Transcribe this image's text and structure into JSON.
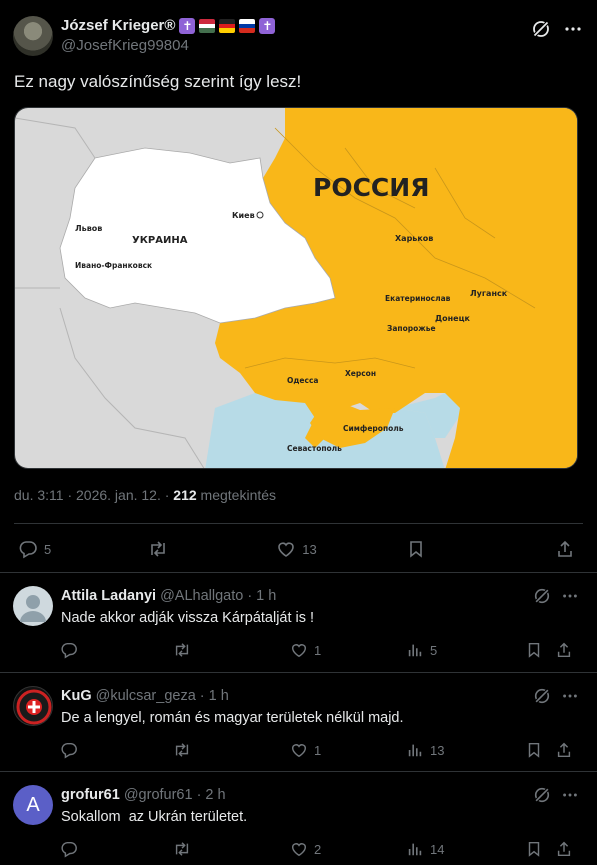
{
  "post": {
    "author_name": "József Krieger®",
    "author_badges": [
      "latin-cross-icon",
      "flag-hungary",
      "flag-germany",
      "flag-russia",
      "latin-cross-icon"
    ],
    "cross_glyph": "✝",
    "handle": "@JosefKrieg99804",
    "text": "Ez nagy valószínűség szerint így lesz!",
    "map_labels": {
      "russia": "РОССИЯ",
      "ukraine": "УКРАИНА",
      "kiev": "Киев",
      "lvov": "Львов",
      "ivano": "Ивано-Франковск",
      "kharkov": "Харьков",
      "ekaterinoslav": "Екатеринослав",
      "lugansk": "Луганск",
      "donetsk": "Донецк",
      "zaporozhye": "Запорожье",
      "odessa": "Одесса",
      "kherson": "Херсон",
      "simferopol": "Симферополь",
      "sevastopol": "Севастополь"
    },
    "timestamp": "du. 3:11 · 2026. jan. 12. ·",
    "views_count": "212",
    "views_label": "megtekintés",
    "stats": {
      "replies": "5",
      "reposts": "",
      "likes": "13"
    }
  },
  "replies": [
    {
      "name": "Attila Ladanyi",
      "handle": "@ALhallgato",
      "time": "· 1 h",
      "text": "Nade akkor adják vissza Kárpátalját is !",
      "replies": "",
      "reposts": "",
      "likes": "1",
      "views": "5"
    },
    {
      "name": "KuG",
      "handle": "@kulcsar_geza",
      "time": "· 1 h",
      "text": "De a lengyel, román és magyar területek nélkül majd.",
      "replies": "",
      "reposts": "",
      "likes": "1",
      "views": "13"
    },
    {
      "name": "grofur61",
      "handle": "@grofur61",
      "time": "· 2 h",
      "text": "Sokallom  az Ukrán területet.",
      "avatar_letter": "A",
      "replies": "",
      "reposts": "",
      "likes": "2",
      "views": "14"
    }
  ],
  "colors": {
    "background": "#000000",
    "text": "#e7e9ea",
    "muted": "#71767b",
    "divider": "#2f3336",
    "map_orange": "#f9b719",
    "map_sea": "#b7dbe7",
    "avatar_purple": "#5b5fc7"
  }
}
